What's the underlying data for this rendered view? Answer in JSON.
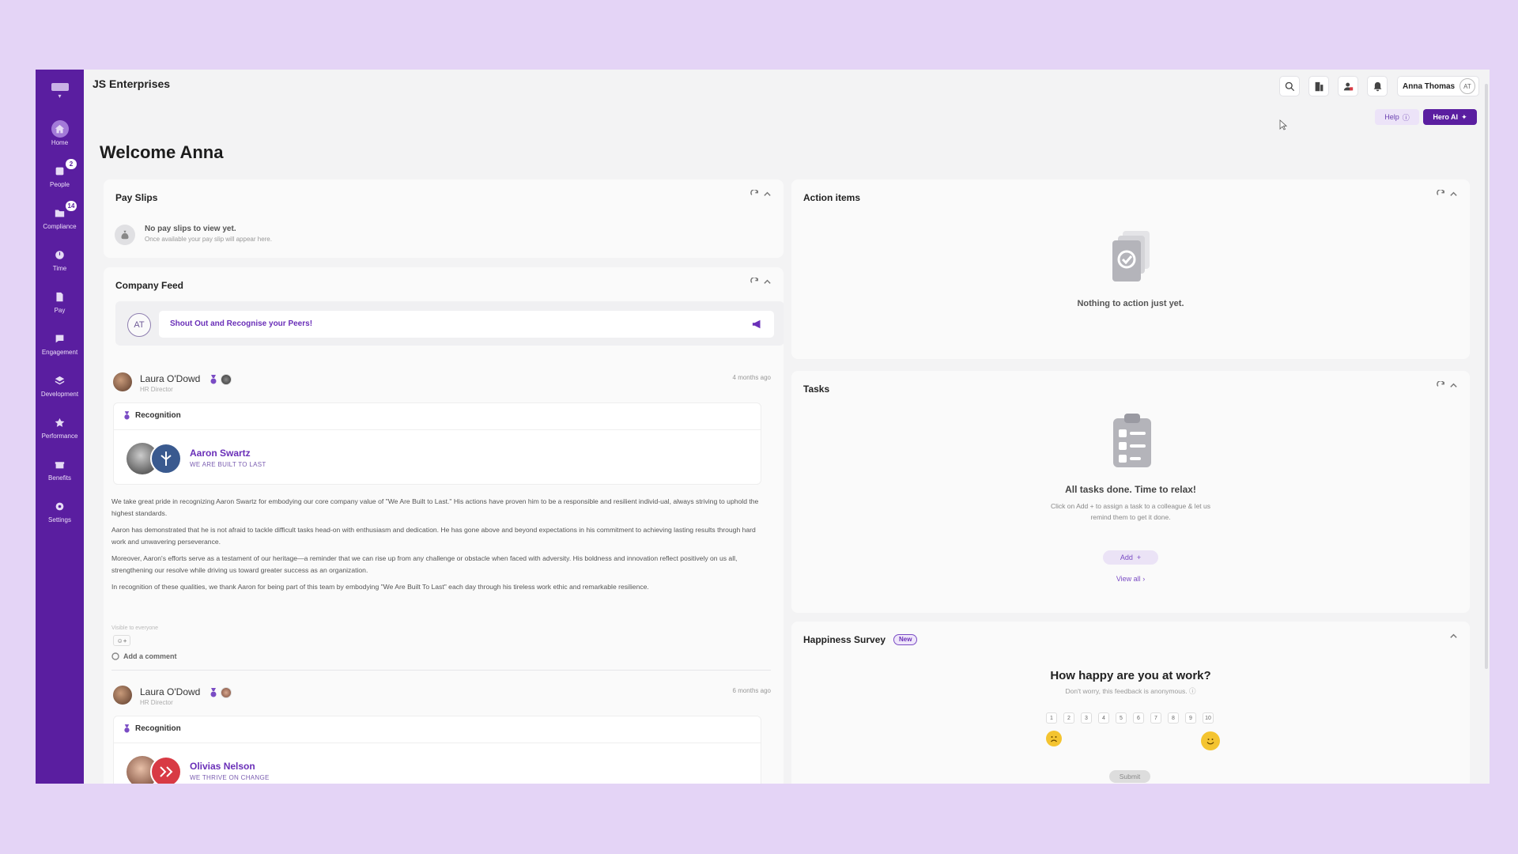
{
  "app": {
    "company": "JS Enterprises",
    "welcome": "Welcome Anna",
    "user_name": "Anna Thomas",
    "user_initials": "AT",
    "help_label": "Help",
    "hero_label": "Hero AI"
  },
  "sidebar": {
    "items": [
      {
        "label": "Home",
        "icon": "home-icon",
        "active": true
      },
      {
        "label": "People",
        "icon": "people-icon",
        "badge": "2"
      },
      {
        "label": "Compliance",
        "icon": "folder-icon",
        "badge": "14"
      },
      {
        "label": "Time",
        "icon": "clock-icon"
      },
      {
        "label": "Pay",
        "icon": "pay-icon"
      },
      {
        "label": "Engagement",
        "icon": "chat-icon"
      },
      {
        "label": "Development",
        "icon": "layers-icon"
      },
      {
        "label": "Performance",
        "icon": "star-icon"
      },
      {
        "label": "Benefits",
        "icon": "gift-icon"
      },
      {
        "label": "Settings",
        "icon": "gear-icon"
      }
    ]
  },
  "payslips": {
    "title": "Pay Slips",
    "empty_title": "No pay slips to view yet.",
    "empty_sub": "Once available your pay slip will appear here."
  },
  "feed": {
    "title": "Company Feed",
    "shout_initials": "AT",
    "shout_text": "Shout Out and Recognise your Peers!",
    "posts": [
      {
        "author": "Laura O'Dowd",
        "role": "HR Director",
        "time": "4 months ago",
        "type": "Recognition",
        "recipient": "Aaron Swartz",
        "value": "WE ARE BUILT TO LAST",
        "paragraphs": [
          "We take great pride in recognizing Aaron Swartz for embodying our core company value of \"We Are Built to Last.\" His actions have proven him to be a responsible and resilient individ-ual, always striving to uphold the highest standards.",
          "Aaron has demonstrated that he is not afraid to tackle difficult tasks head-on with enthusiasm and dedication. He has gone above and beyond expectations in his commitment to achieving lasting results through hard work and unwavering perseverance.",
          "Moreover, Aaron's efforts serve as a testament of our heritage—a reminder that we can rise up from any challenge or obstacle when faced with adversity. His boldness and innovation reflect positively on us all, strengthening our resolve while driving us toward greater success as an organization.",
          "In recognition of these qualities, we thank Aaron for being part of this team by embodying \"We Are Built To Last\" each day through his tireless work ethic and remarkable resilience."
        ],
        "visibility": "Visible to everyone",
        "add_comment": "Add a comment"
      },
      {
        "author": "Laura O'Dowd",
        "role": "HR Director",
        "time": "6 months ago",
        "type": "Recognition",
        "recipient": "Olivias Nelson",
        "value": "WE THRIVE ON CHANGE"
      }
    ]
  },
  "actions": {
    "title": "Action items",
    "empty": "Nothing to action just yet."
  },
  "tasks": {
    "title": "Tasks",
    "empty_title": "All tasks done. Time to relax!",
    "empty_sub_1": "Click on Add + to assign a task to a colleague & let us",
    "empty_sub_2": "remind them to get it done.",
    "add_label": "Add",
    "view_all": "View all"
  },
  "survey": {
    "title": "Happiness Survey",
    "badge": "New",
    "question": "How happy are you at work?",
    "sub": "Don't worry, this feedback is anonymous.",
    "scale": [
      "1",
      "2",
      "3",
      "4",
      "5",
      "6",
      "7",
      "8",
      "9",
      "10"
    ],
    "submit": "Submit"
  },
  "colors": {
    "brand": "#5a1ea0",
    "accent": "#6a2fb8",
    "background": "#e4d4f6"
  }
}
